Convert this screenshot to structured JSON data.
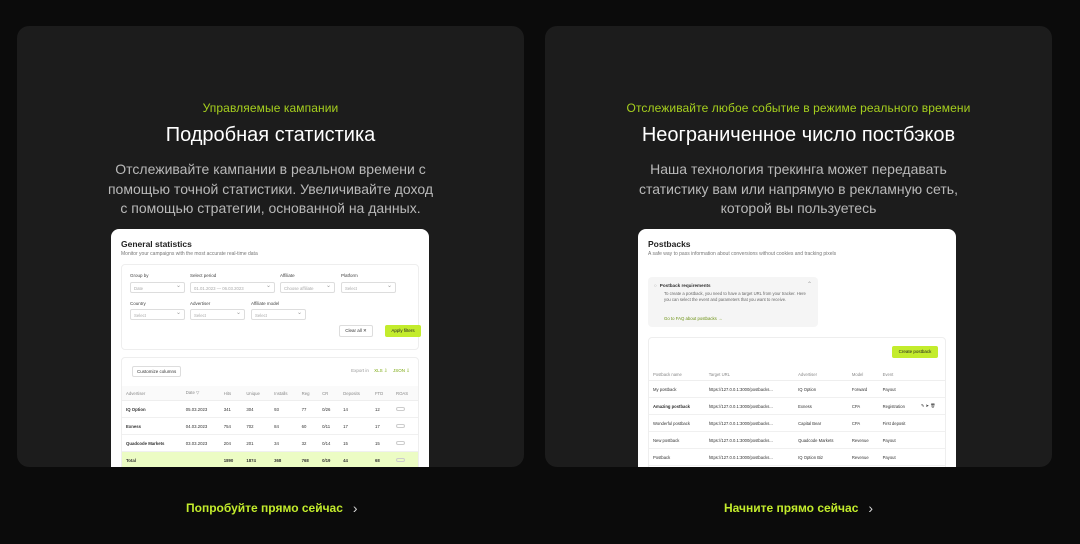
{
  "left_card": {
    "eyebrow": "Управляемые кампании",
    "title": "Подробная статистика",
    "description": "Отслеживайте кампании в реальном времени с помощью точной статистики. Увеличивайте доход с помощью стратегии, основанной на данных.",
    "cta": "Попробуйте прямо сейчас",
    "screenshot": {
      "title": "General statistics",
      "subtitle": "Monitor your campaigns with the most accurate real-time data",
      "filters": {
        "group_by_label": "Group by",
        "group_by_value": "Date",
        "period_label": "Select period",
        "period_value": "01.01.2023 — 06.03.2023",
        "affiliate_label": "Affiliate",
        "affiliate_placeholder": "Choose affiliate",
        "platform_label": "Platform",
        "platform_placeholder": "Select",
        "country_label": "Country",
        "country_placeholder": "Select",
        "advertiser_label": "Advertiser",
        "advertiser_placeholder": "Select",
        "affiliate_model_label": "Affiliate model",
        "affiliate_model_placeholder": "Select",
        "clear_all": "Clear all ✕",
        "apply": "Apply filters"
      },
      "customize": "Customize columns",
      "export_label": "Export in",
      "export_xls": "XLS ⇩",
      "export_json": "JSON ⇩",
      "columns": [
        "Advertiser",
        "Date ▽",
        "Hits",
        "Unique",
        "Installs",
        "Reg",
        "CR",
        "Deposits",
        "FTD",
        "ROAS"
      ],
      "rows": [
        [
          "IQ Option",
          "05.03.2023",
          "341",
          "304",
          "93",
          "77",
          "0/26",
          "14",
          "12"
        ],
        [
          "Exness",
          "04.03.2023",
          "754",
          "702",
          "84",
          "60",
          "0/11",
          "17",
          "17"
        ],
        [
          "Quadcode Markets",
          "03.03.2023",
          "204",
          "201",
          "34",
          "32",
          "0/14",
          "15",
          "15"
        ]
      ],
      "total": [
        "Total",
        "",
        "1890",
        "1874",
        "368",
        "768",
        "0/19",
        "44",
        "68"
      ]
    }
  },
  "right_card": {
    "eyebrow": "Отслеживайте любое событие в режиме реального времени",
    "title": "Неограниченное число постбэков",
    "description": "Наша технология трекинга может передавать статистику вам или напрямую в рекламную сеть, которой вы пользуетесь",
    "cta": "Начните прямо сейчас",
    "screenshot": {
      "title": "Postbacks",
      "subtitle": "A safe way to pass information about conversions without cookies and tracking pixels",
      "req_title": "Postback requirements",
      "req_text": "To create a postback, you need to have a target URL from your tracker. Here you can select the event and parameters that you want to receive.",
      "req_link": "Go to FAQ about postbacks →",
      "create": "Create postback",
      "columns": [
        "Postback name",
        "Target URL",
        "Advertiser",
        "Model",
        "Event",
        ""
      ],
      "rows": [
        [
          "My postback",
          "https://127.0.0.1:3000/postbacks...",
          "IQ Option",
          "Forward",
          "Payout"
        ],
        [
          "Amazing postback",
          "https://127.0.0.1:3000/postbacks...",
          "Exness",
          "CPA",
          "Registration"
        ],
        [
          "Wonderful postback",
          "https://127.0.0.1:3000/postbacks...",
          "Capital Bear",
          "CPA",
          "First deposit"
        ],
        [
          "New postback",
          "https://127.0.0.1:3000/postbacks...",
          "Quadcode Markets",
          "Revenue",
          "Payout"
        ],
        [
          "Postback",
          "https://127.0.0.1:3000/postbacks...",
          "IQ Option Biz",
          "Revenue",
          "Payout"
        ]
      ]
    }
  }
}
